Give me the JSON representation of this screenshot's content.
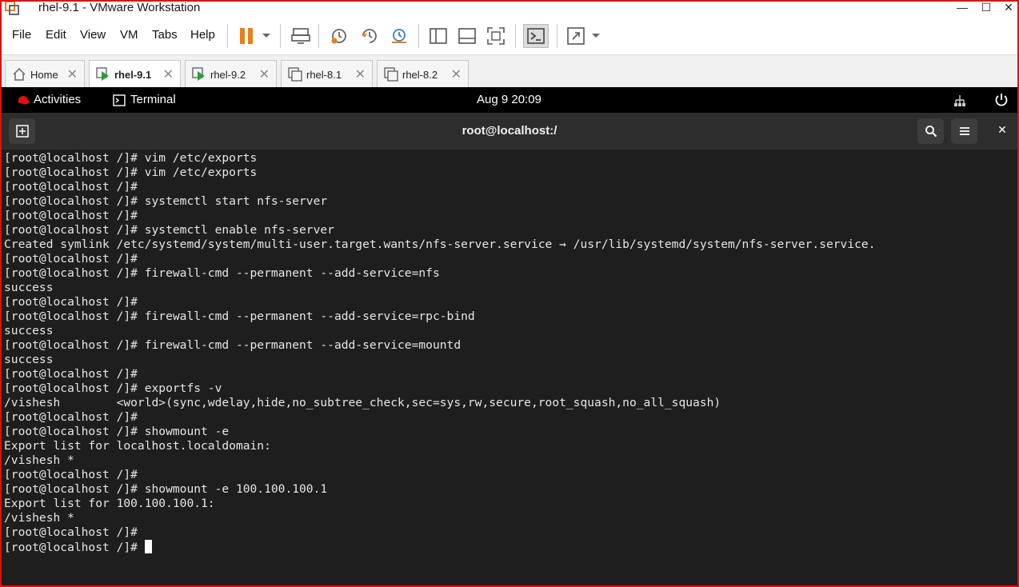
{
  "window": {
    "title": "rhel-9.1 - VMware Workstation",
    "minimize_icon": "minimize-icon",
    "maximize_icon": "maximize-icon",
    "close_icon": "close-icon"
  },
  "menu": {
    "items": [
      "File",
      "Edit",
      "View",
      "VM",
      "Tabs",
      "Help"
    ]
  },
  "toolbar": {
    "icons": [
      "pause-icon",
      "dropdown-icon",
      "send-keys-icon",
      "snapshot-icon",
      "revert-snapshot-icon",
      "snapshot-manager-icon",
      "library-icon",
      "thumbnail-bar-icon",
      "fullscreen-icon",
      "console-view-icon",
      "stretch-icon",
      "dropdown-icon"
    ],
    "accent": "#e8801a"
  },
  "tabs": [
    {
      "label": "Home",
      "icon": "home-icon",
      "active": false
    },
    {
      "label": "rhel-9.1",
      "icon": "vm-running-icon",
      "active": true
    },
    {
      "label": "rhel-9.2",
      "icon": "vm-running-icon",
      "active": false
    },
    {
      "label": "rhel-8.1",
      "icon": "vm-icon",
      "active": false
    },
    {
      "label": "rhel-8.2",
      "icon": "vm-icon",
      "active": false
    }
  ],
  "gnome": {
    "activities": "Activities",
    "app": "Terminal",
    "clock": "Aug 9  20:09",
    "accent": "#e01010"
  },
  "terminal": {
    "title": "root@localhost:/",
    "lines": [
      "[root@localhost /]# vim /etc/exports",
      "[root@localhost /]# vim /etc/exports",
      "[root@localhost /]#",
      "[root@localhost /]# systemctl start nfs-server",
      "[root@localhost /]#",
      "[root@localhost /]# systemctl enable nfs-server",
      "Created symlink /etc/systemd/system/multi-user.target.wants/nfs-server.service → /usr/lib/systemd/system/nfs-server.service.",
      "[root@localhost /]#",
      "[root@localhost /]# firewall-cmd --permanent --add-service=nfs",
      "success",
      "[root@localhost /]#",
      "[root@localhost /]# firewall-cmd --permanent --add-service=rpc-bind",
      "success",
      "[root@localhost /]# firewall-cmd --permanent --add-service=mountd",
      "success",
      "[root@localhost /]#",
      "[root@localhost /]# exportfs -v",
      "/vishesh        <world>(sync,wdelay,hide,no_subtree_check,sec=sys,rw,secure,root_squash,no_all_squash)",
      "[root@localhost /]#",
      "[root@localhost /]# showmount -e",
      "Export list for localhost.localdomain:",
      "/vishesh *",
      "[root@localhost /]#",
      "[root@localhost /]# showmount -e 100.100.100.1",
      "Export list for 100.100.100.1:",
      "/vishesh *",
      "[root@localhost /]#",
      "[root@localhost /]# "
    ],
    "background": "#1e1e1e",
    "foreground": "#e6e6e6"
  }
}
